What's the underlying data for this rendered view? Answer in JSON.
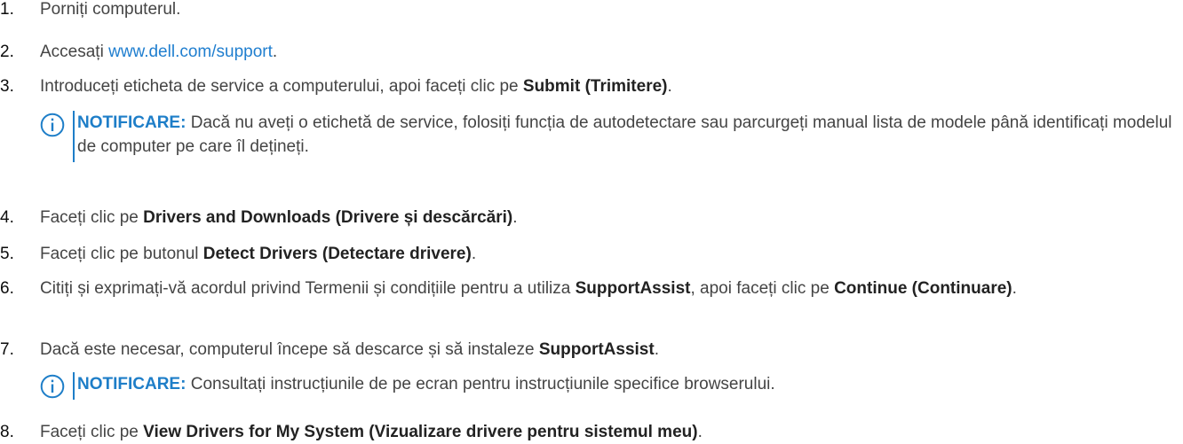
{
  "steps": [
    {
      "num": "1.",
      "parts": [
        {
          "t": "Porniți computerul."
        }
      ]
    },
    {
      "num": "2.",
      "parts": [
        {
          "t": "Accesați "
        },
        {
          "t": "www.dell.com/support",
          "link": true
        },
        {
          "t": "."
        }
      ]
    },
    {
      "num": "3.",
      "parts": [
        {
          "t": "Introduceți eticheta de service a computerului, apoi faceți clic pe "
        },
        {
          "t": "Submit (Trimitere)",
          "bold": true
        },
        {
          "t": "."
        }
      ]
    },
    {
      "num": "4.",
      "parts": [
        {
          "t": "Faceți clic pe "
        },
        {
          "t": "Drivers and Downloads (Drivere și descărcări)",
          "bold": true
        },
        {
          "t": "."
        }
      ]
    },
    {
      "num": "5.",
      "parts": [
        {
          "t": "Faceți clic pe butonul "
        },
        {
          "t": "Detect Drivers (Detectare drivere)",
          "bold": true
        },
        {
          "t": "."
        }
      ]
    },
    {
      "num": "6.",
      "parts": [
        {
          "t": "Citiți și exprimați-vă acordul privind Termenii și condițiile pentru a utiliza "
        },
        {
          "t": "SupportAssist",
          "bold": true
        },
        {
          "t": ", apoi faceți clic pe "
        },
        {
          "t": "Continue (Continuare)",
          "bold": true
        },
        {
          "t": "."
        }
      ]
    },
    {
      "num": "7.",
      "parts": [
        {
          "t": "Dacă este necesar, computerul începe să descarce și să instaleze "
        },
        {
          "t": "SupportAssist",
          "bold": true
        },
        {
          "t": "."
        }
      ]
    },
    {
      "num": "8.",
      "parts": [
        {
          "t": "Faceți clic pe "
        },
        {
          "t": "View Drivers for My System (Vizualizare drivere pentru sistemul meu)",
          "bold": true
        },
        {
          "t": "."
        }
      ]
    }
  ],
  "notes": {
    "note1": {
      "label": "NOTIFICARE:",
      "text": " Dacă nu aveți o etichetă de service, folosiți funcția de autodetectare sau parcurgeți manual lista de modele până identificați modelul de computer pe care îl dețineți."
    },
    "note2": {
      "label": "NOTIFICARE:",
      "text": " Consultați instrucțiunile de pe ecran pentru instrucțiunile specifice browserului."
    }
  },
  "icons": {
    "note_icon": "info-icon"
  },
  "colors": {
    "link": "#1f7ecf",
    "note_accent": "#1e7ec8",
    "body_text": "#444444"
  }
}
